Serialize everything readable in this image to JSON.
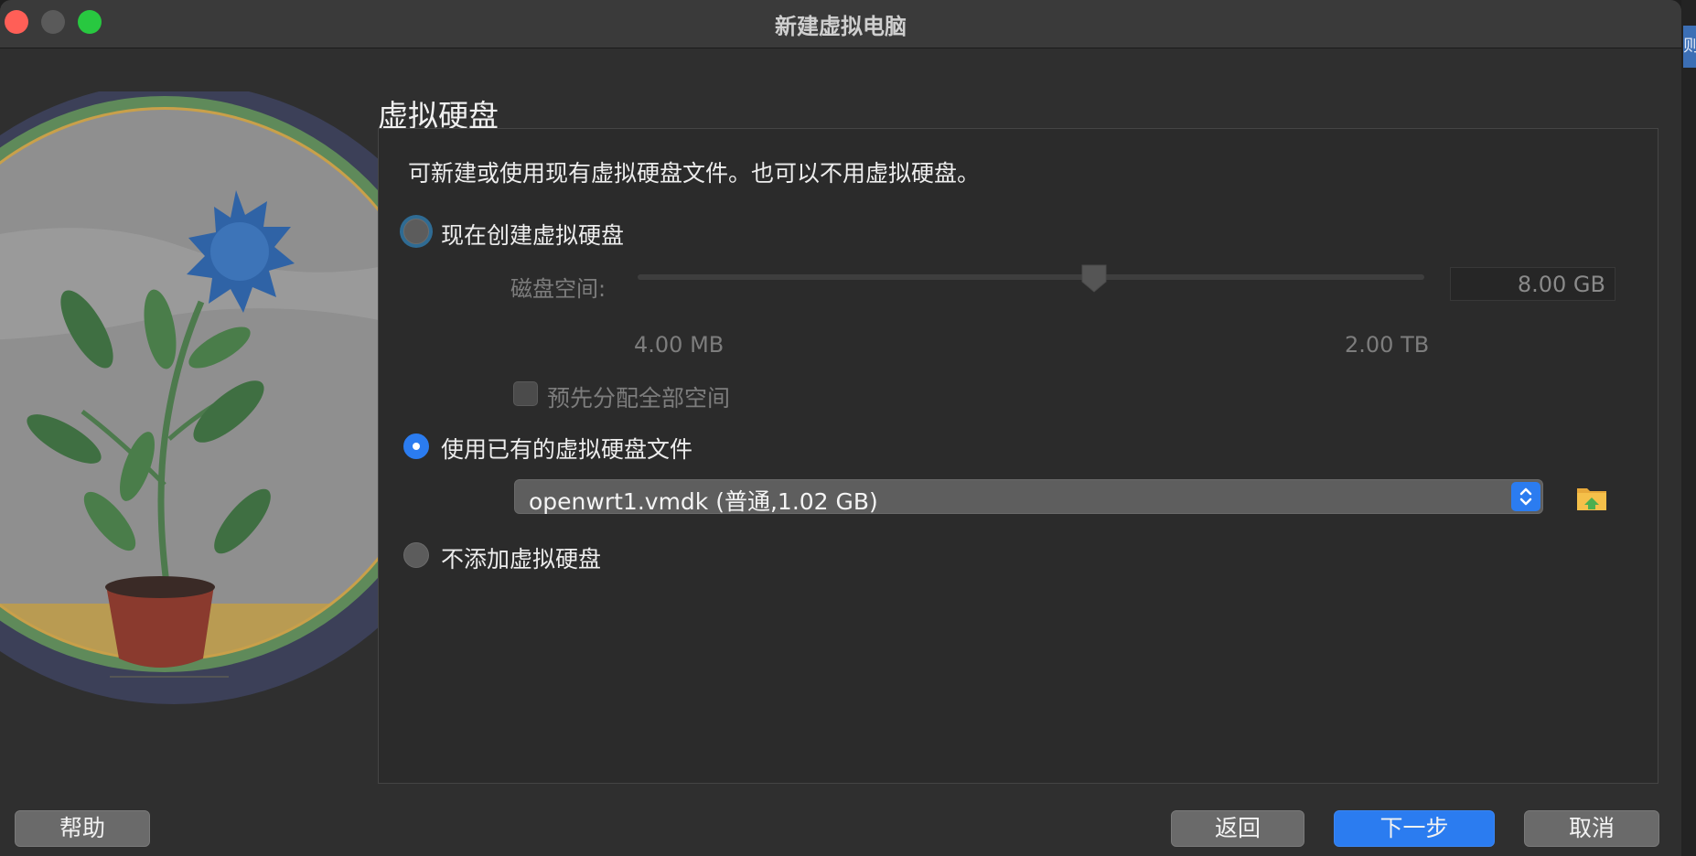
{
  "window": {
    "title": "新建虚拟电脑"
  },
  "page": {
    "title": "虚拟硬盘",
    "description": "可新建或使用现有虚拟硬盘文件。也可以不用虚拟硬盘。"
  },
  "options": {
    "create_now": {
      "label": "现在创建虚拟硬盘",
      "selected": false
    },
    "use_existing": {
      "label": "使用已有的虚拟硬盘文件",
      "selected": true
    },
    "no_disk": {
      "label": "不添加虚拟硬盘",
      "selected": false
    }
  },
  "disk_size": {
    "label": "磁盘空间:",
    "value": "8.00 GB",
    "min_label": "4.00 MB",
    "max_label": "2.00 TB",
    "slider_fraction": 0.58,
    "enabled": false
  },
  "preallocate": {
    "label": "预先分配全部空间",
    "checked": false,
    "enabled": false
  },
  "existing_file": {
    "selected": "openwrt1.vmdk (普通,1.02 GB)"
  },
  "icons": {
    "select_stepper": "chevron-updown-icon",
    "folder": "folder-open-icon"
  },
  "buttons": {
    "help": "帮助",
    "back": "返回",
    "next": "下一步",
    "cancel": "取消"
  },
  "side_tab": {
    "text": "则"
  },
  "colors": {
    "accent": "#2b7cf0",
    "window_bg": "#2f2f2f",
    "close": "#ff5f57",
    "maximize": "#28c840"
  }
}
